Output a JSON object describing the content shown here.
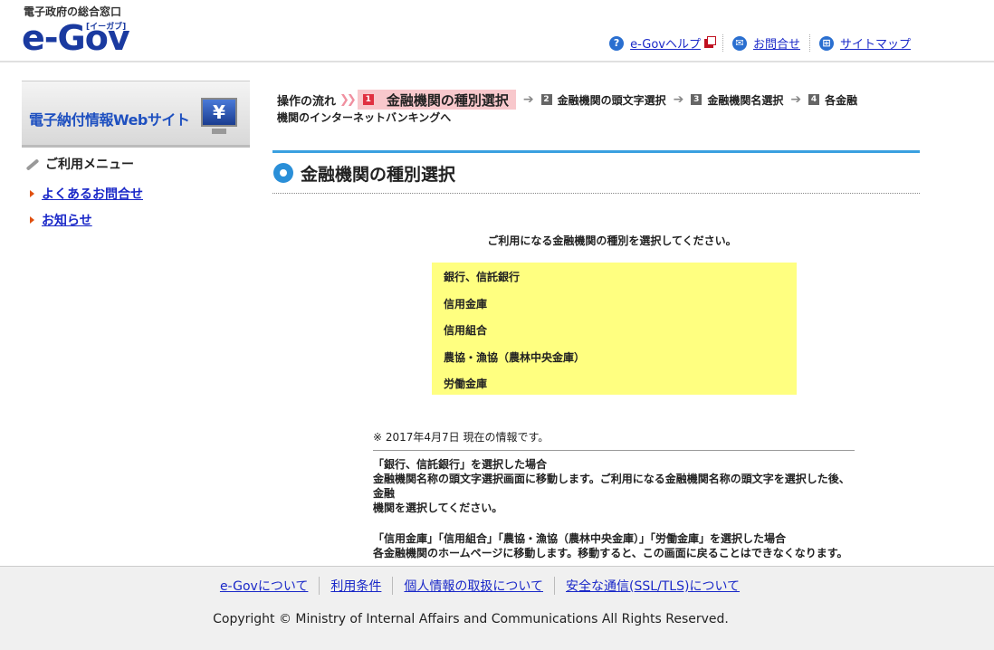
{
  "header": {
    "logo_sub": "電子政府の総合窓口",
    "logo_main": "e-Gov",
    "logo_kana": "[イーガブ]",
    "links": [
      {
        "label": "e-Govヘルプ"
      },
      {
        "label": "お問合せ"
      },
      {
        "label": "サイトマップ"
      }
    ]
  },
  "sidebar": {
    "banner_text": "電子納付情報Webサイト",
    "banner_icon": "¥",
    "menu_title": "ご利用メニュー",
    "items": [
      {
        "label": "よくあるお問合せ"
      },
      {
        "label": "お知らせ"
      }
    ]
  },
  "flow": {
    "label": "操作の流れ",
    "steps": [
      {
        "num": "1",
        "label": "金融機関の種別選択"
      },
      {
        "num": "2",
        "label": "金融機関の頭文字選択"
      },
      {
        "num": "3",
        "label": "金融機関名選択"
      },
      {
        "num": "4",
        "label": "各金融"
      }
    ],
    "continuation": "機関のインターネットバンキングへ"
  },
  "page_title": "金融機関の種別選択",
  "instruction": "ご利用になる金融機関の種別を選択してください。",
  "choices": [
    {
      "label": "銀行、信託銀行"
    },
    {
      "label": "信用金庫"
    },
    {
      "label": "信用組合"
    },
    {
      "label": "農協・漁協（農林中央金庫）"
    },
    {
      "label": "労働金庫"
    }
  ],
  "notes": {
    "date": "※ 2017年4月7日 現在の情報です。",
    "block1_title": "「銀行、信託銀行」を選択した場合",
    "block1_line1": "金融機関名称の頭文字選択画面に移動します。ご利用になる金融機関名称の頭文字を選択した後、金融",
    "block1_line2": "機関を選択してください。",
    "block2_title": "「信用金庫」「信用組合」「農協・漁協（農林中央金庫）」「労働金庫」を選択した場合",
    "block2_line1": "各金融機関のホームページに移動します。移動すると、この画面に戻ることはできなくなります。"
  },
  "footer": {
    "links": [
      {
        "label": "e-Govについて"
      },
      {
        "label": "利用条件"
      },
      {
        "label": "個人情報の取扱について"
      },
      {
        "label": "安全な通信(SSL/TLS)について"
      }
    ],
    "copyright": "Copyright © Ministry of Internal Affairs and Communications All Rights Reserved."
  },
  "colors": {
    "link": "#1a28c8",
    "accent_blue": "#2a8fd8",
    "choice_bg": "#ffff80",
    "active_step_bg": "#f8c8cc"
  }
}
